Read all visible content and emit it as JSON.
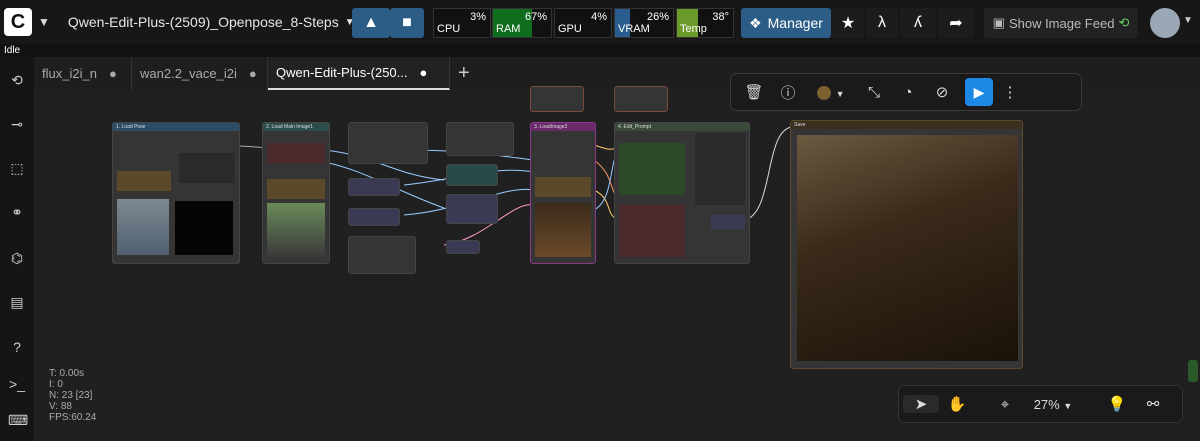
{
  "header": {
    "workflow_title": "Qwen-Edit-Plus-(2509)_Openpose_8-Steps",
    "cpu": {
      "label": "CPU",
      "value": "3%",
      "fill": 0.03
    },
    "ram": {
      "label": "RAM",
      "value": "67%",
      "fill": 0.67
    },
    "gpu": {
      "label": "GPU",
      "value": "4%",
      "fill": 0.04
    },
    "vram": {
      "label": "VRAM",
      "value": "26%",
      "fill": 0.26
    },
    "temp": {
      "label": "Temp",
      "value": "38°",
      "fill": 0.38
    },
    "manager_label": "Manager",
    "image_feed_label": "Show Image Feed"
  },
  "status": {
    "text": "Idle"
  },
  "tabs": [
    {
      "label": "flux_i2i_n"
    },
    {
      "label": "wan2.2_vace_i2i"
    },
    {
      "label": "Qwen-Edit-Plus-(250..."
    }
  ],
  "nodes": {
    "load_pose": "1. Load Pose",
    "load_main": "2. Load Main Image1",
    "load_image2": "3. LoadImage2",
    "edit_prompt": "4. Edit_Prompt",
    "save": "Save"
  },
  "zoom": "27%",
  "stats": {
    "t": "T: 0.00s",
    "i": "I: 0",
    "n": "N: 23 [23]",
    "v": "V: 88",
    "fps": "FPS:60.24"
  },
  "colors": {
    "accent": "#2b5d87",
    "run": "#1e88e5",
    "ram_fill": "#0f6e1e",
    "vram_fill": "#2a5d8f",
    "temp_fill": "#6a9a2a"
  }
}
